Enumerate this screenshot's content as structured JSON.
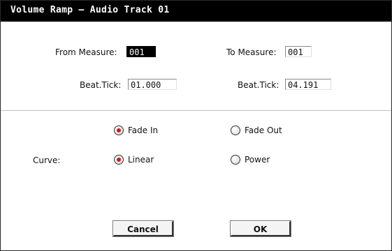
{
  "dialog": {
    "title": "Volume Ramp – Audio Track 01"
  },
  "from": {
    "measure_label": "From Measure:",
    "measure_value": "001",
    "beat_label": "Beat.Tick:",
    "beat_value": "01.000"
  },
  "to": {
    "measure_label": "To Measure:",
    "measure_value": "001",
    "beat_label": "Beat.Tick:",
    "beat_value": "04.191"
  },
  "fade": {
    "options": [
      {
        "label": "Fade In",
        "selected": true
      },
      {
        "label": "Fade Out",
        "selected": false
      }
    ]
  },
  "curve": {
    "label": "Curve:",
    "options": [
      {
        "label": "Linear",
        "selected": true
      },
      {
        "label": "Power",
        "selected": false
      }
    ]
  },
  "buttons": {
    "cancel": "Cancel",
    "ok": "OK"
  },
  "colors": {
    "titlebar": "#000000",
    "radio_selected": "#d01a1a"
  }
}
